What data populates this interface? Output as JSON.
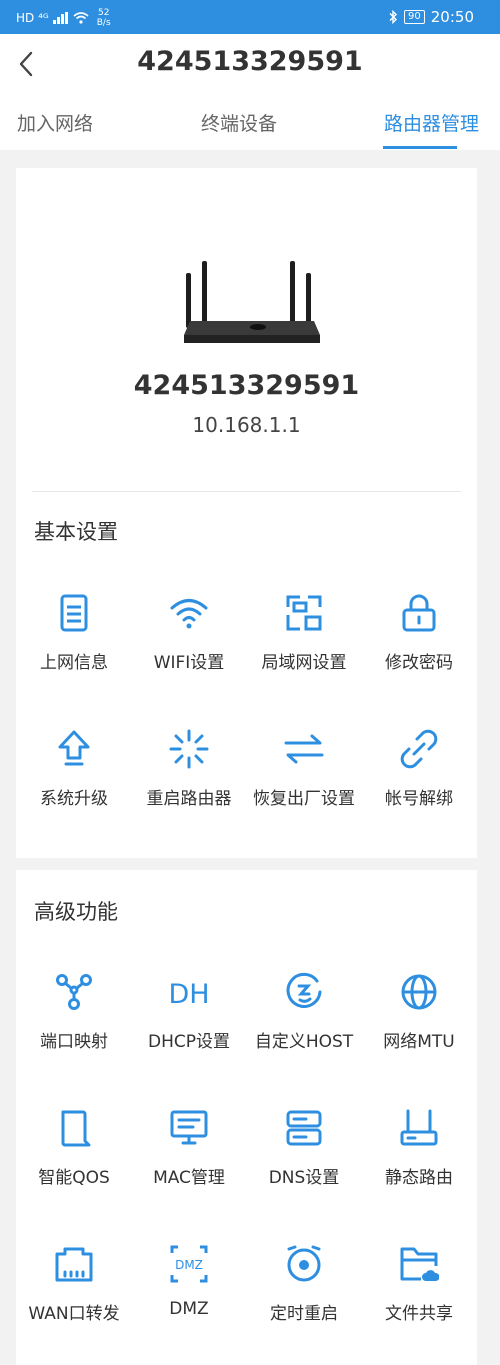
{
  "status_bar": {
    "left_icons": "HD ⁴ᴳ",
    "net_speed_value": "52",
    "net_speed_unit": "B/s",
    "battery": "90",
    "time": "20:50"
  },
  "header": {
    "title": "424513329591"
  },
  "tabs": [
    {
      "label": "加入网络"
    },
    {
      "label": "终端设备"
    },
    {
      "label": "路由器管理"
    }
  ],
  "device": {
    "name": "424513329591",
    "ip": "10.168.1.1"
  },
  "basic": {
    "title": "基本设置",
    "items": [
      {
        "label": "上网信息",
        "icon": "document-icon"
      },
      {
        "label": "WIFI设置",
        "icon": "wifi-icon"
      },
      {
        "label": "局域网设置",
        "icon": "lan-icon"
      },
      {
        "label": "修改密码",
        "icon": "lock-icon"
      },
      {
        "label": "系统升级",
        "icon": "upgrade-arrow-icon"
      },
      {
        "label": "重启路由器",
        "icon": "loading-spinner-icon"
      },
      {
        "label": "恢复出厂设置",
        "icon": "swap-arrows-icon"
      },
      {
        "label": "帐号解绑",
        "icon": "unlink-icon"
      }
    ]
  },
  "advanced": {
    "title": "高级功能",
    "items": [
      {
        "label": "端口映射",
        "icon": "port-mapping-icon"
      },
      {
        "label": "DHCP设置",
        "icon": "dhcp-icon",
        "icon_text": "DH"
      },
      {
        "label": "自定义HOST",
        "icon": "host-icon"
      },
      {
        "label": "网络MTU",
        "icon": "globe-icon"
      },
      {
        "label": "智能QOS",
        "icon": "qos-icon"
      },
      {
        "label": "MAC管理",
        "icon": "monitor-icon"
      },
      {
        "label": "DNS设置",
        "icon": "server-icon"
      },
      {
        "label": "静态路由",
        "icon": "router-icon"
      },
      {
        "label": "WAN口转发",
        "icon": "ethernet-port-icon"
      },
      {
        "label": "DMZ",
        "icon": "dmz-icon",
        "icon_text": "DMZ"
      },
      {
        "label": "定时重启",
        "icon": "alarm-clock-icon"
      },
      {
        "label": "文件共享",
        "icon": "cloud-folder-icon"
      }
    ]
  },
  "colors": {
    "accent": "#2e8fe0",
    "background": "#f2f2f2",
    "card": "#ffffff"
  }
}
